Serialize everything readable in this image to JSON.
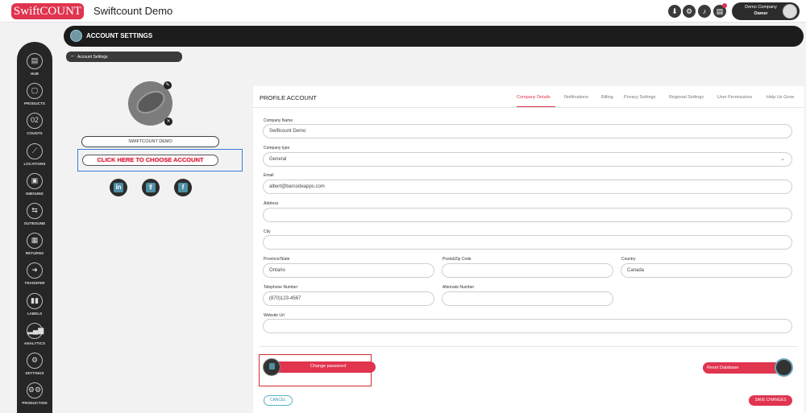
{
  "topbar": {
    "logo_text": "SwiftCOUNT",
    "app_title": "Swiftcount Demo",
    "icons": [
      "download-icon",
      "gear-icon",
      "bell-icon",
      "document-icon"
    ],
    "user": {
      "company": "Demo Company",
      "role": "Owner"
    }
  },
  "rail": {
    "items": [
      {
        "label": "HUB",
        "icon": "hub-icon",
        "glyph": "▤"
      },
      {
        "label": "PRODUCTS",
        "icon": "products-icon",
        "glyph": "▢"
      },
      {
        "label": "COUNTS",
        "icon": "counts-icon",
        "glyph": "02"
      },
      {
        "label": "LOCATIONS",
        "icon": "locations-icon",
        "glyph": "⟋"
      },
      {
        "label": "INBOUND",
        "icon": "inbound-icon",
        "glyph": "▣"
      },
      {
        "label": "OUTBOUND",
        "icon": "outbound-icon",
        "glyph": "⇆"
      },
      {
        "label": "RETURNS",
        "icon": "returns-icon",
        "glyph": "▦"
      },
      {
        "label": "TRANSFER",
        "icon": "transfer-icon",
        "glyph": "➜"
      },
      {
        "label": "LABELS",
        "icon": "labels-icon",
        "glyph": "▮▮"
      },
      {
        "label": "ANALYTICS",
        "icon": "analytics-icon",
        "glyph": "▂▄▆"
      },
      {
        "label": "SETTINGS",
        "icon": "settings-icon",
        "glyph": "⚙"
      },
      {
        "label": "PRODUCTION",
        "icon": "production-icon",
        "glyph": "⚙⚙"
      }
    ]
  },
  "header": {
    "title": "ACCOUNT SETTINGS",
    "breadcrumb": "Account Settings"
  },
  "profile": {
    "company_name_display": "SWIFTCOUNT DEMO",
    "choose_account": "CLICK HERE TO CHOOSE ACCOUNT",
    "social": [
      {
        "icon": "linkedin-icon",
        "glyph": "in"
      },
      {
        "icon": "share-icon",
        "glyph": "⇪"
      },
      {
        "icon": "facebook-icon",
        "glyph": "f"
      }
    ]
  },
  "card": {
    "title": "PROFILE ACCOUNT",
    "tabs": [
      "Company Details",
      "Notifications",
      "Billing",
      "Privacy Settings",
      "Regional Settings",
      "User Permissions",
      "Help Us Grow"
    ],
    "active_tab": "Company Details",
    "fields": {
      "company_name": {
        "label": "Company Name",
        "value": "Swiftcount Demo"
      },
      "company_type": {
        "label": "Company type",
        "value": "General"
      },
      "email": {
        "label": "Email",
        "value": "albert@barcodeapps.com"
      },
      "address": {
        "label": "Address",
        "value": ""
      },
      "city": {
        "label": "City",
        "value": ""
      },
      "province": {
        "label": "Province/State",
        "value": "Ontario"
      },
      "postal": {
        "label": "Postal/Zip Code",
        "value": ""
      },
      "country": {
        "label": "Country",
        "value": "Canada"
      },
      "telephone": {
        "label": "Telephone Number",
        "value": "(870)123-4567"
      },
      "alternate": {
        "label": "Alternate Number",
        "value": ""
      },
      "website": {
        "label": "Website Url",
        "value": ""
      }
    },
    "change_password": "Change password",
    "reset_database": "Reset Database",
    "cancel": "CANCEL",
    "save": "SAVE CHANGES"
  },
  "colors": {
    "accent": "#e0344f",
    "dark": "#262626",
    "teal": "#4f8fa5"
  }
}
